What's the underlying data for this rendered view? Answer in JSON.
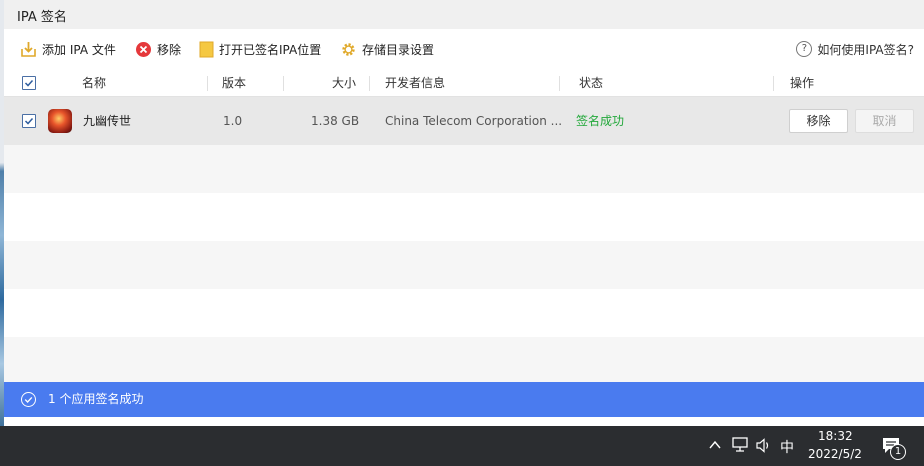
{
  "window": {
    "title": "IPA 签名"
  },
  "toolbar": {
    "add_label": "添加 IPA 文件",
    "remove_label": "移除",
    "open_signed_label": "打开已签名IPA位置",
    "storage_settings_label": "存储目录设置",
    "help_label": "如何使用IPA签名?"
  },
  "table": {
    "columns": [
      "名称",
      "版本",
      "大小",
      "开发者信息",
      "状态",
      "操作"
    ],
    "rows": [
      {
        "name": "九幽传世",
        "version": "1.0",
        "size": "1.38 GB",
        "developer": "China Telecom Corporation ...",
        "status": "签名成功",
        "remove": "移除",
        "cancel": "取消",
        "checked": true
      }
    ]
  },
  "status_bar": {
    "message": "1 个应用签名成功"
  },
  "taskbar": {
    "ime": "中",
    "time": "18:32",
    "date": "2022/5/2",
    "notification_count": "1"
  },
  "colors": {
    "accent": "#4a7bef",
    "success": "#22a83a",
    "remove_icon": "#e5383b",
    "folder_icon": "#f5c842"
  }
}
